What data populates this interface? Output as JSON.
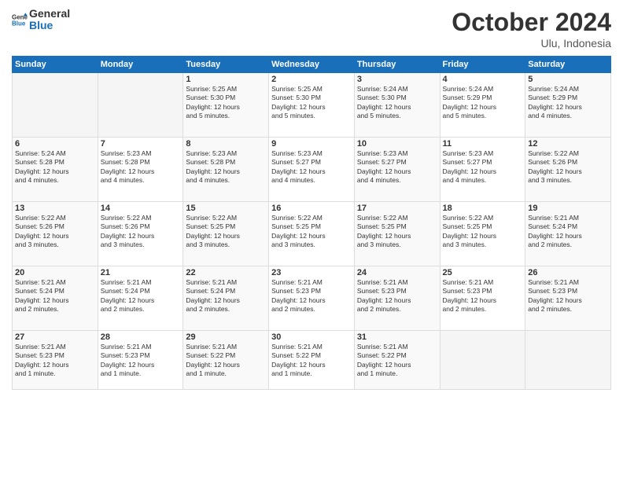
{
  "header": {
    "logo_general": "General",
    "logo_blue": "Blue",
    "month": "October 2024",
    "location": "Ulu, Indonesia"
  },
  "days_of_week": [
    "Sunday",
    "Monday",
    "Tuesday",
    "Wednesday",
    "Thursday",
    "Friday",
    "Saturday"
  ],
  "weeks": [
    [
      {
        "day": "",
        "info": ""
      },
      {
        "day": "",
        "info": ""
      },
      {
        "day": "1",
        "info": "Sunrise: 5:25 AM\nSunset: 5:30 PM\nDaylight: 12 hours\nand 5 minutes."
      },
      {
        "day": "2",
        "info": "Sunrise: 5:25 AM\nSunset: 5:30 PM\nDaylight: 12 hours\nand 5 minutes."
      },
      {
        "day": "3",
        "info": "Sunrise: 5:24 AM\nSunset: 5:30 PM\nDaylight: 12 hours\nand 5 minutes."
      },
      {
        "day": "4",
        "info": "Sunrise: 5:24 AM\nSunset: 5:29 PM\nDaylight: 12 hours\nand 5 minutes."
      },
      {
        "day": "5",
        "info": "Sunrise: 5:24 AM\nSunset: 5:29 PM\nDaylight: 12 hours\nand 4 minutes."
      }
    ],
    [
      {
        "day": "6",
        "info": "Sunrise: 5:24 AM\nSunset: 5:28 PM\nDaylight: 12 hours\nand 4 minutes."
      },
      {
        "day": "7",
        "info": "Sunrise: 5:23 AM\nSunset: 5:28 PM\nDaylight: 12 hours\nand 4 minutes."
      },
      {
        "day": "8",
        "info": "Sunrise: 5:23 AM\nSunset: 5:28 PM\nDaylight: 12 hours\nand 4 minutes."
      },
      {
        "day": "9",
        "info": "Sunrise: 5:23 AM\nSunset: 5:27 PM\nDaylight: 12 hours\nand 4 minutes."
      },
      {
        "day": "10",
        "info": "Sunrise: 5:23 AM\nSunset: 5:27 PM\nDaylight: 12 hours\nand 4 minutes."
      },
      {
        "day": "11",
        "info": "Sunrise: 5:23 AM\nSunset: 5:27 PM\nDaylight: 12 hours\nand 4 minutes."
      },
      {
        "day": "12",
        "info": "Sunrise: 5:22 AM\nSunset: 5:26 PM\nDaylight: 12 hours\nand 3 minutes."
      }
    ],
    [
      {
        "day": "13",
        "info": "Sunrise: 5:22 AM\nSunset: 5:26 PM\nDaylight: 12 hours\nand 3 minutes."
      },
      {
        "day": "14",
        "info": "Sunrise: 5:22 AM\nSunset: 5:26 PM\nDaylight: 12 hours\nand 3 minutes."
      },
      {
        "day": "15",
        "info": "Sunrise: 5:22 AM\nSunset: 5:25 PM\nDaylight: 12 hours\nand 3 minutes."
      },
      {
        "day": "16",
        "info": "Sunrise: 5:22 AM\nSunset: 5:25 PM\nDaylight: 12 hours\nand 3 minutes."
      },
      {
        "day": "17",
        "info": "Sunrise: 5:22 AM\nSunset: 5:25 PM\nDaylight: 12 hours\nand 3 minutes."
      },
      {
        "day": "18",
        "info": "Sunrise: 5:22 AM\nSunset: 5:25 PM\nDaylight: 12 hours\nand 3 minutes."
      },
      {
        "day": "19",
        "info": "Sunrise: 5:21 AM\nSunset: 5:24 PM\nDaylight: 12 hours\nand 2 minutes."
      }
    ],
    [
      {
        "day": "20",
        "info": "Sunrise: 5:21 AM\nSunset: 5:24 PM\nDaylight: 12 hours\nand 2 minutes."
      },
      {
        "day": "21",
        "info": "Sunrise: 5:21 AM\nSunset: 5:24 PM\nDaylight: 12 hours\nand 2 minutes."
      },
      {
        "day": "22",
        "info": "Sunrise: 5:21 AM\nSunset: 5:24 PM\nDaylight: 12 hours\nand 2 minutes."
      },
      {
        "day": "23",
        "info": "Sunrise: 5:21 AM\nSunset: 5:23 PM\nDaylight: 12 hours\nand 2 minutes."
      },
      {
        "day": "24",
        "info": "Sunrise: 5:21 AM\nSunset: 5:23 PM\nDaylight: 12 hours\nand 2 minutes."
      },
      {
        "day": "25",
        "info": "Sunrise: 5:21 AM\nSunset: 5:23 PM\nDaylight: 12 hours\nand 2 minutes."
      },
      {
        "day": "26",
        "info": "Sunrise: 5:21 AM\nSunset: 5:23 PM\nDaylight: 12 hours\nand 2 minutes."
      }
    ],
    [
      {
        "day": "27",
        "info": "Sunrise: 5:21 AM\nSunset: 5:23 PM\nDaylight: 12 hours\nand 1 minute."
      },
      {
        "day": "28",
        "info": "Sunrise: 5:21 AM\nSunset: 5:23 PM\nDaylight: 12 hours\nand 1 minute."
      },
      {
        "day": "29",
        "info": "Sunrise: 5:21 AM\nSunset: 5:22 PM\nDaylight: 12 hours\nand 1 minute."
      },
      {
        "day": "30",
        "info": "Sunrise: 5:21 AM\nSunset: 5:22 PM\nDaylight: 12 hours\nand 1 minute."
      },
      {
        "day": "31",
        "info": "Sunrise: 5:21 AM\nSunset: 5:22 PM\nDaylight: 12 hours\nand 1 minute."
      },
      {
        "day": "",
        "info": ""
      },
      {
        "day": "",
        "info": ""
      }
    ]
  ]
}
